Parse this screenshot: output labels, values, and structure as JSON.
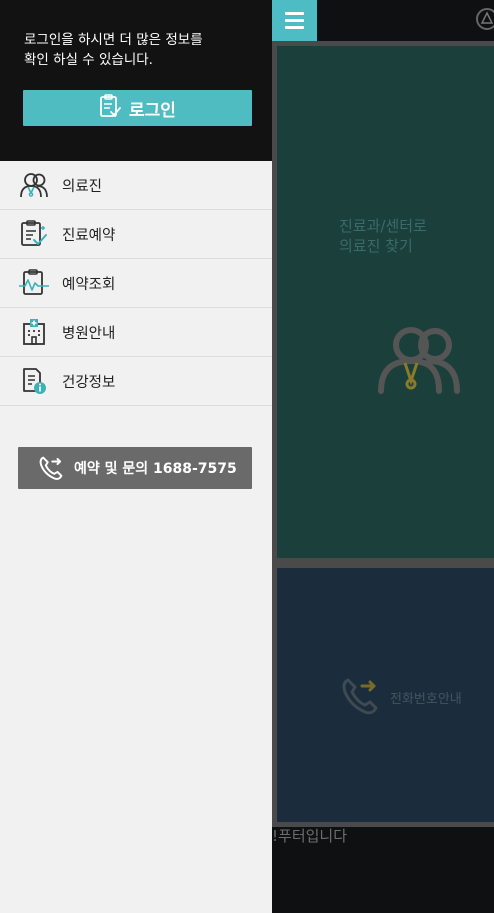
{
  "background": {
    "doctor_tile": {
      "text": "진료과/센터로\n의료진 찾기",
      "icon": "doctors-icon"
    },
    "phone_tile": {
      "text": "전화번호안내",
      "icon": "phone-icon"
    },
    "footer_text": "푸터입니다!",
    "menu_icon": "hamburger-icon",
    "logo_icon": "logo-icon"
  },
  "drawer": {
    "login_message": "로그인을 하시면 더 많은 정보를\n확인 하실 수 있습니다.",
    "login_button": {
      "label": "로그인",
      "icon": "clipboard-icon"
    },
    "nav_items": [
      {
        "label": "의료진",
        "icon": "doctor-icon"
      },
      {
        "label": "진료예약",
        "icon": "reservation-icon"
      },
      {
        "label": "예약조회",
        "icon": "inquiry-icon"
      },
      {
        "label": "병원안내",
        "icon": "hospital-icon"
      },
      {
        "label": "건강정보",
        "icon": "health-info-icon"
      }
    ],
    "call_button": {
      "label": "예약 및 문의 1688-7575",
      "icon": "phone-icon"
    }
  },
  "colors": {
    "accent": "#4fbcc2",
    "drawer_bg": "#f1f1f1",
    "header_bg": "#121212",
    "call_bg": "#6a6a6a"
  }
}
